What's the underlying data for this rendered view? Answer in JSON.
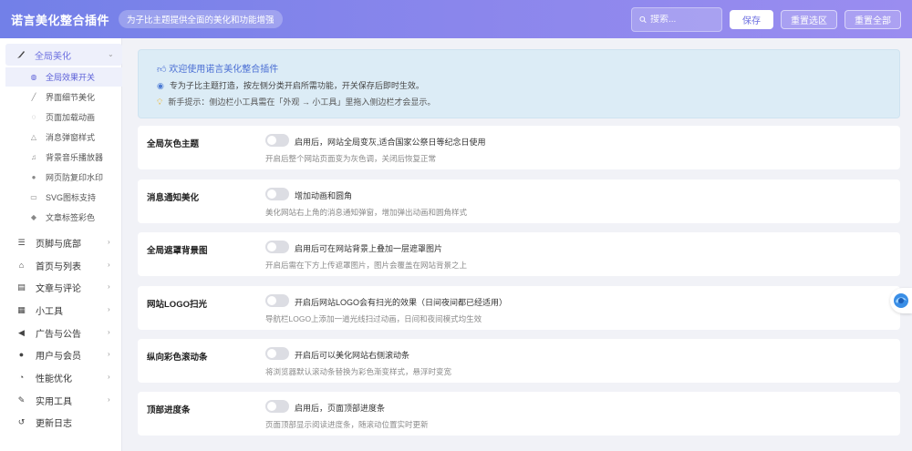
{
  "header": {
    "title": "诺言美化整合插件",
    "tagline": "为子比主题提供全面的美化和功能增强",
    "search_placeholder": "搜索...",
    "save_label": "保存",
    "reset_section_label": "重置选区",
    "reset_all_label": "重置全部"
  },
  "sidebar": {
    "active_group": {
      "label": "全局美化",
      "icon": "brush-icon",
      "expanded": true
    },
    "sub_items": [
      {
        "label": "全局效果开关",
        "icon": "globe-icon",
        "active": true
      },
      {
        "label": "界面细节美化",
        "icon": "paintbrush-icon",
        "active": false
      },
      {
        "label": "页面加载动画",
        "icon": "spinner-icon",
        "active": false
      },
      {
        "label": "消息弹窗样式",
        "icon": "bell-icon",
        "active": false
      },
      {
        "label": "背景音乐播放器",
        "icon": "music-icon",
        "active": false
      },
      {
        "label": "网页防复印水印",
        "icon": "drop-icon",
        "active": false
      },
      {
        "label": "SVG图标支持",
        "icon": "image-icon",
        "active": false
      },
      {
        "label": "文章标签彩色",
        "icon": "tag-icon",
        "active": false
      }
    ],
    "groups": [
      {
        "label": "页脚与底部",
        "icon": "layout-icon",
        "has_children": true
      },
      {
        "label": "首页与列表",
        "icon": "home-icon",
        "has_children": true
      },
      {
        "label": "文章与评论",
        "icon": "document-icon",
        "has_children": true
      },
      {
        "label": "小工具",
        "icon": "grid-icon",
        "has_children": true
      },
      {
        "label": "广告与公告",
        "icon": "megaphone-icon",
        "has_children": true
      },
      {
        "label": "用户与会员",
        "icon": "user-icon",
        "has_children": true
      },
      {
        "label": "性能优化",
        "icon": "gauge-icon",
        "has_children": true
      },
      {
        "label": "实用工具",
        "icon": "wrench-icon",
        "has_children": true
      },
      {
        "label": "更新日志",
        "icon": "history-icon",
        "has_children": false
      }
    ]
  },
  "welcome": {
    "title": "欢迎使用诺言美化整合插件",
    "line1": "专为子比主题打造，按左侧分类开启所需功能，开关保存后即时生效。",
    "line2": "新手提示：侧边栏小工具需在「外观 → 小工具」里拖入侧边栏才会显示。"
  },
  "settings": [
    {
      "name": "全局灰色主题",
      "toggle_label": "启用后，网站全局变灰,适合国家公祭日等纪念日使用",
      "desc": "开启后整个网站页面变为灰色调，关闭后恢复正常",
      "enabled": false
    },
    {
      "name": "消息通知美化",
      "toggle_label": "增加动画和圆角",
      "desc": "美化网站右上角的消息通知弹窗，增加弹出动画和圆角样式",
      "enabled": false
    },
    {
      "name": "全局遮罩背景图",
      "toggle_label": "启用后可在网站背景上叠加一层遮罩图片",
      "desc": "开启后需在下方上传遮罩图片，图片会覆盖在网站背景之上",
      "enabled": false
    },
    {
      "name": "网站LOGO扫光",
      "toggle_label": "开启后网站LOGO会有扫光的效果（日间夜间都已经适用）",
      "desc": "导航栏LOGO上添加一道光线扫过动画，日间和夜间模式均生效",
      "enabled": false
    },
    {
      "name": "纵向彩色滚动条",
      "toggle_label": "开启后可以美化网站右侧滚动条",
      "desc": "将浏览器默认滚动条替换为彩色渐变样式，悬浮时变宽",
      "enabled": false
    },
    {
      "name": "顶部进度条",
      "toggle_label": "启用后，页面顶部进度条",
      "desc": "页面顶部显示阅读进度条，随滚动位置实时更新",
      "enabled": false
    }
  ]
}
